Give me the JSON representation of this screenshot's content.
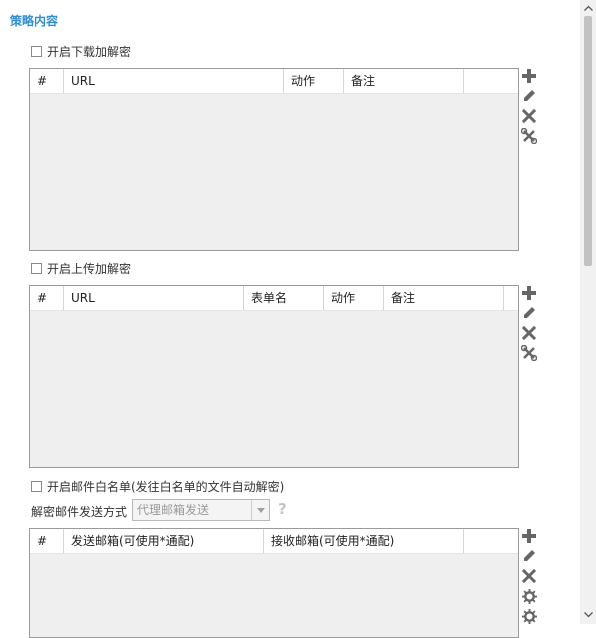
{
  "section_title": "策略内容",
  "download": {
    "checkbox_label": "开启下载加解密",
    "columns": [
      "#",
      "URL",
      "动作",
      "备注"
    ]
  },
  "upload": {
    "checkbox_label": "开启上传加解密",
    "columns": [
      "#",
      "URL",
      "表单名",
      "动作",
      "备注"
    ]
  },
  "mail": {
    "checkbox_label": "开启邮件白名单(发往白名单的文件自动解密)",
    "send_mode_label": "解密邮件发送方式",
    "send_mode_value": "代理邮箱发送",
    "help": "?",
    "columns": [
      "#",
      "发送邮箱(可使用*通配)",
      "接收邮箱(可使用*通配)"
    ]
  },
  "icons": [
    "plus-icon",
    "edit-icon",
    "delete-icon",
    "clear-icon",
    "gear-icon"
  ],
  "colors": {
    "accent": "#2b8fd6",
    "table_body": "#efefef",
    "icon": "#666666"
  }
}
